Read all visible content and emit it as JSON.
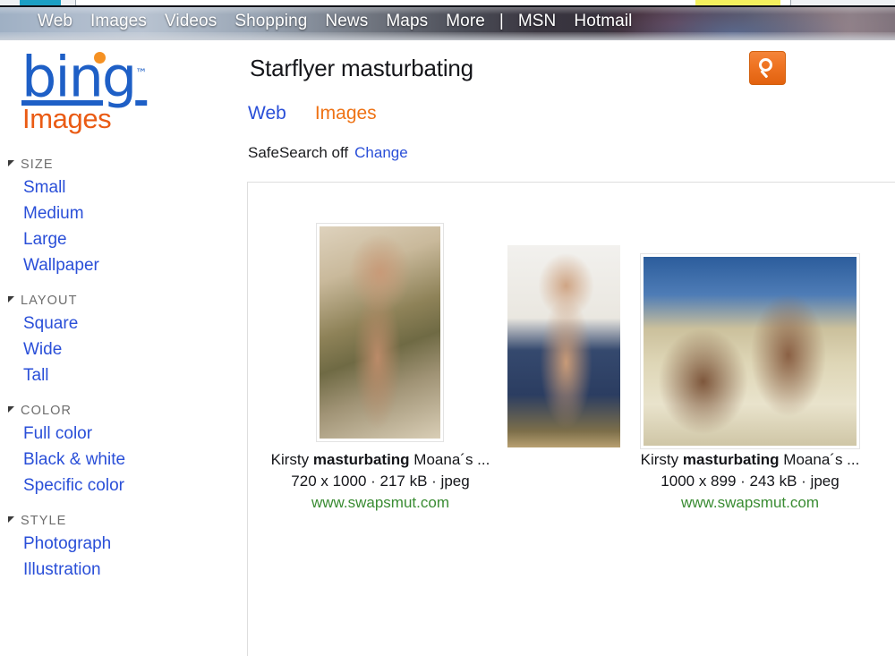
{
  "browser": {
    "chrome_visible": true
  },
  "topnav": {
    "items": [
      {
        "label": "Web",
        "name": "topnav-web"
      },
      {
        "label": "Images",
        "name": "topnav-images"
      },
      {
        "label": "Videos",
        "name": "topnav-videos"
      },
      {
        "label": "Shopping",
        "name": "topnav-shopping"
      },
      {
        "label": "News",
        "name": "topnav-news"
      },
      {
        "label": "Maps",
        "name": "topnav-maps"
      },
      {
        "label": "More",
        "name": "topnav-more"
      }
    ],
    "separator": "|",
    "right_items": [
      {
        "label": "MSN",
        "name": "topnav-msn"
      },
      {
        "label": "Hotmail",
        "name": "topnav-hotmail"
      }
    ]
  },
  "brand": {
    "logo_text": "bing",
    "trademark": "™",
    "vertical": "Images",
    "logo_color": "#1e5fc6",
    "dot_color": "#f59123",
    "vertical_color": "#ea5b14"
  },
  "sidebar": {
    "groups": [
      {
        "title": "SIZE",
        "items": [
          "Small",
          "Medium",
          "Large",
          "Wallpaper"
        ]
      },
      {
        "title": "LAYOUT",
        "items": [
          "Square",
          "Wide",
          "Tall"
        ]
      },
      {
        "title": "COLOR",
        "items": [
          "Full color",
          "Black & white",
          "Specific color"
        ]
      },
      {
        "title": "STYLE",
        "items": [
          "Photograph",
          "Illustration"
        ]
      }
    ],
    "link_color": "#2a4fd8",
    "title_color": "#6e6e6e"
  },
  "search": {
    "query": "Starflyer masturbating",
    "button_icon": "search-icon",
    "button_color": "#ef7423"
  },
  "scopes": [
    {
      "label": "Web",
      "active": false,
      "color": "#2a4fd8"
    },
    {
      "label": "Images",
      "active": true,
      "color": "#ee7214"
    }
  ],
  "safesearch": {
    "status": "SafeSearch off",
    "change_label": "Change"
  },
  "results": [
    {
      "title_prefix": "Kirsty ",
      "title_bold": "masturbating",
      "title_suffix": " Moana´s ...",
      "meta": "720 x 1000 · 217 kB · jpeg",
      "url": "www.swapsmut.com",
      "alt": "thumbnail-result-1"
    },
    {
      "title_prefix": "",
      "title_bold": "",
      "title_suffix": "",
      "meta": "",
      "url": "",
      "alt": "thumbnail-result-2"
    },
    {
      "title_prefix": "Kirsty ",
      "title_bold": "masturbating",
      "title_suffix": " Moana´s ...",
      "meta": "1000 x 899 · 243 kB · jpeg",
      "url": "www.swapsmut.com",
      "alt": "thumbnail-result-3"
    }
  ]
}
